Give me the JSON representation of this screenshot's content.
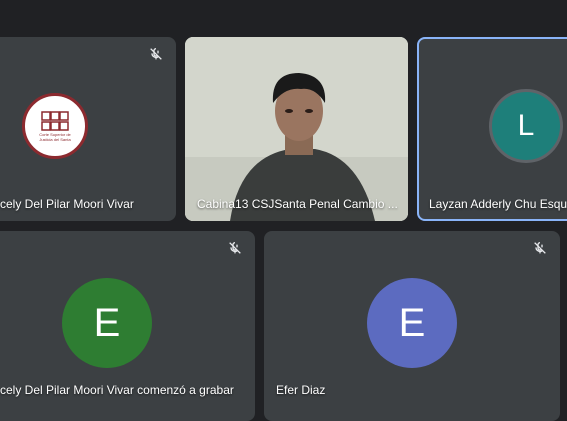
{
  "tiles": [
    {
      "name": "cely Del Pilar Moori Vivar",
      "logo_text": "Corte Superior de Justicia del Santa",
      "muted": true
    },
    {
      "name": "Cabina13 CSJSanta Penal Cambio ..."
    },
    {
      "name": "Layzan Adderly Chu Esque",
      "avatar_letter": "L",
      "avatar_color": "#1e7f7a",
      "active": true
    },
    {
      "name": "cely Del Pilar Moori Vivar comenzó a grabar",
      "avatar_letter": "E",
      "avatar_color": "#2e7d32",
      "muted": true
    },
    {
      "name": "Efer Diaz",
      "avatar_letter": "E",
      "avatar_color": "#5c6bc0",
      "muted": true
    }
  ]
}
